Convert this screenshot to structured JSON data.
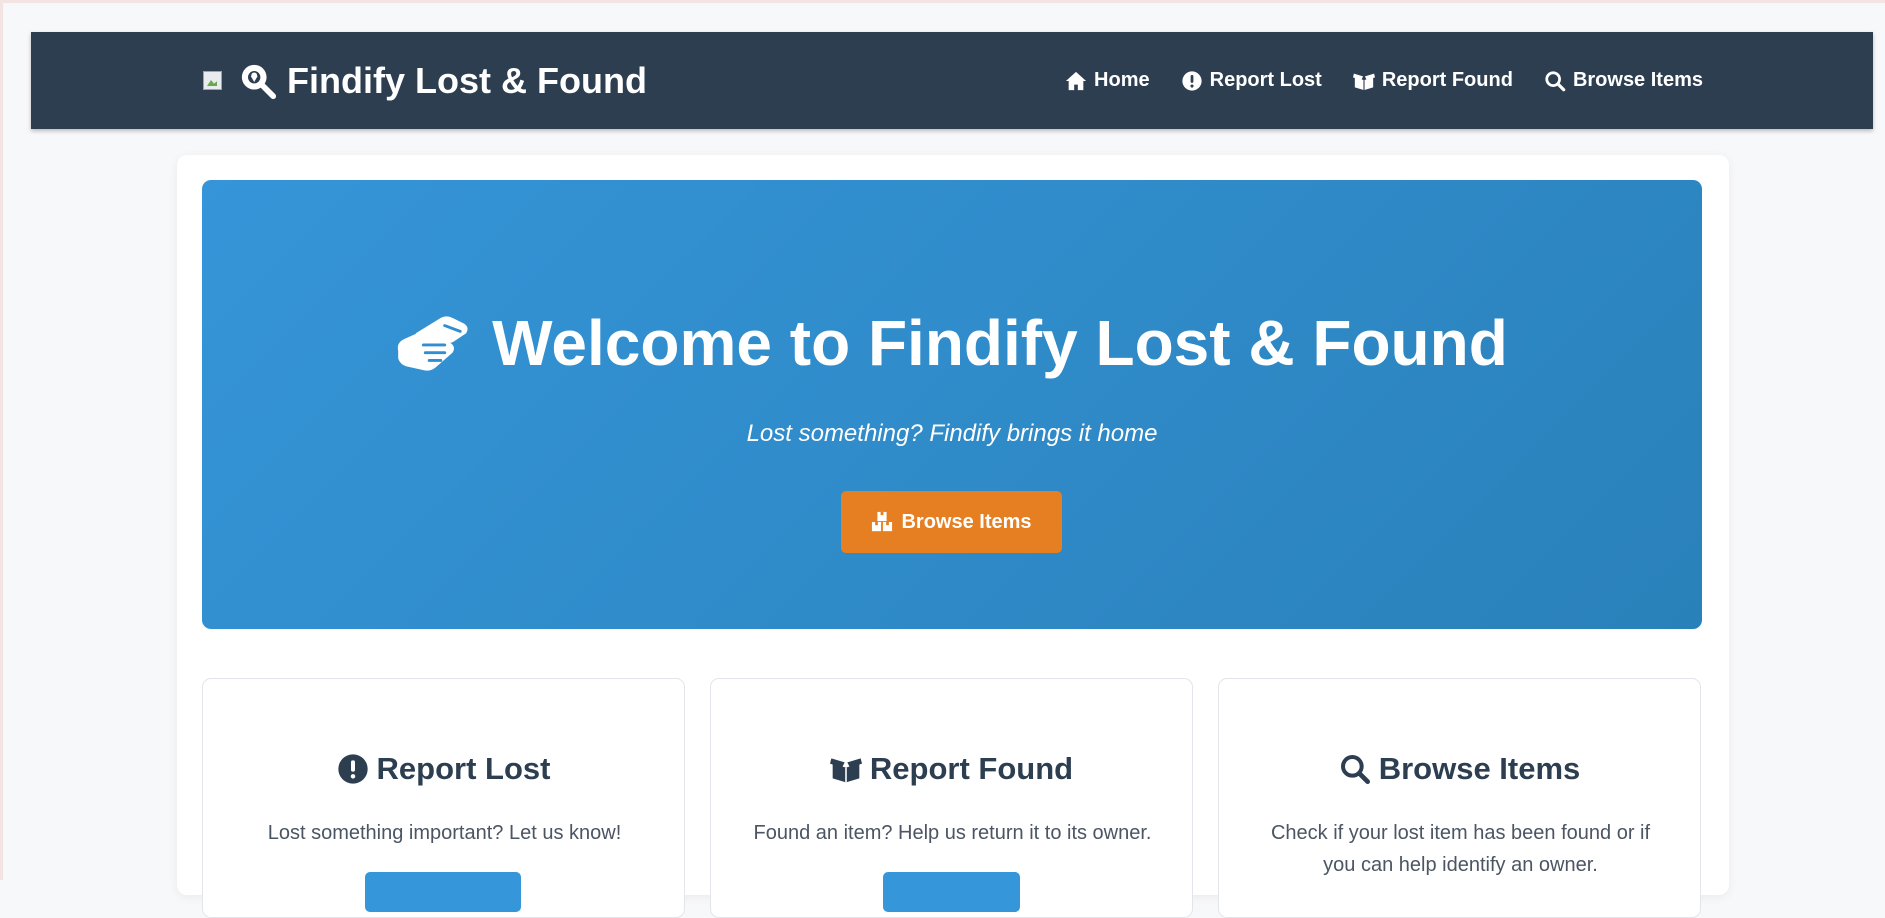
{
  "colors": {
    "navbar_bg": "#2d3e50",
    "hero_gradient_start": "#3595d8",
    "hero_gradient_end": "#2a81ba",
    "accent_orange": "#e67e22",
    "primary_blue": "#3596d9",
    "heading_text": "#2c3e50"
  },
  "navbar": {
    "brand_icon": "search-location-icon",
    "brand_text": "Findify Lost & Found",
    "links": [
      {
        "label": "Home",
        "icon": "home-icon"
      },
      {
        "label": "Report Lost",
        "icon": "exclamation-circle-icon"
      },
      {
        "label": "Report Found",
        "icon": "box-open-icon"
      },
      {
        "label": "Browse Items",
        "icon": "search-icon"
      }
    ]
  },
  "hero": {
    "icon": "handshake-icon",
    "title": "Welcome to Findify Lost & Found",
    "tagline": "Lost something? Findify brings it home",
    "button_icon": "boxes-icon",
    "button_label": "Browse Items"
  },
  "features": [
    {
      "icon": "exclamation-circle-icon",
      "title": "Report Lost",
      "description": "Lost something important? Let us know!"
    },
    {
      "icon": "box-open-icon",
      "title": "Report Found",
      "description": "Found an item? Help us return it to its owner."
    },
    {
      "icon": "search-icon",
      "title": "Browse Items",
      "description": "Check if your lost item has been found or if you can help identify an owner."
    }
  ]
}
